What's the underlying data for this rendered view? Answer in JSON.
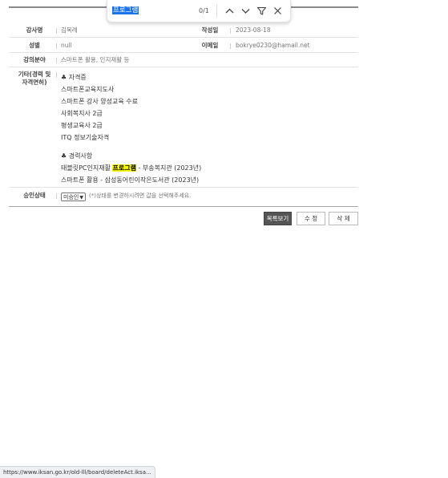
{
  "find_bar": {
    "query": "프로그램",
    "match_count": "0/1",
    "prev_icon": "chevron-up-icon",
    "next_icon": "chevron-down-icon",
    "filter_icon": "filter-icon",
    "close_icon": "close-icon"
  },
  "form": {
    "instructor_label": "강사명",
    "instructor_value": "김복례",
    "date_label": "작성일",
    "date_value": "2023-08-18",
    "gender_label": "성별",
    "gender_value": "null",
    "email_label": "이메일",
    "email_value": "bokrye0230@hamail.net",
    "field_label": "강의분야",
    "field_value": "스마트폰 활용, 인지재활 등",
    "other_label_line1": "기타(경력 및",
    "other_label_line2": "자격면허)",
    "approval_label": "승인상태",
    "approval_selected": "미승인",
    "approval_hint": "(*)상태를 변경하시려면 값을 선택해주세요."
  },
  "career": {
    "cert_title": "♣ 자격증",
    "certs": [
      "스마트폰교육지도사",
      "스마트폰 강사 양성교육 수료",
      "사회복지사 2급",
      "평생교육사 2급",
      "ITQ 정보기술자격"
    ],
    "exp_title": "♣ 경력사항",
    "exp1_before": "태블릿PC인지재활 ",
    "exp1_highlight": "프로그램",
    "exp1_after": " - 부송복지관 (2023년)",
    "exp2": "스마트폰 활용 -  삼성동어린이작은도서관 (2023년)"
  },
  "buttons": {
    "list": "목록보기",
    "edit": "수 정",
    "delete": "삭 제"
  },
  "status_url": "https://www.iksan.go.kr/old-lll/board/deleteAct.iksa...",
  "colors": {
    "highlight": "#ffff00",
    "find_selection": "#1a73e8",
    "list_button_bg": "#555555"
  }
}
